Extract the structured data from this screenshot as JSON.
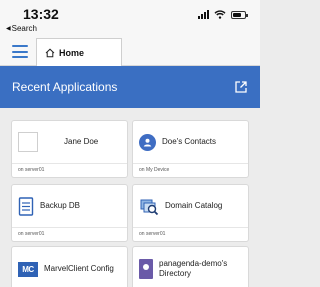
{
  "status": {
    "time": "13:32",
    "back_label": "Search"
  },
  "nav": {
    "home_label": "Home"
  },
  "recent": {
    "title": "Recent Applications"
  },
  "apps": [
    {
      "name": "Jane Doe",
      "location": "on server01",
      "icon": "blank-placeholder-icon"
    },
    {
      "name": "Doe's Contacts",
      "location": "on My Device",
      "icon": "contacts-icon"
    },
    {
      "name": "Backup DB",
      "location": "on server01",
      "icon": "document-icon"
    },
    {
      "name": "Domain Catalog",
      "location": "on server01",
      "icon": "catalog-icon"
    },
    {
      "name": "MarvelClient Config",
      "location": "",
      "icon": "mc-logo-icon"
    },
    {
      "name": "panagenda-demo's Directory",
      "location": "",
      "icon": "directory-icon"
    }
  ],
  "colors": {
    "accent": "#3a6fc2",
    "menu": "#3a78c9"
  }
}
